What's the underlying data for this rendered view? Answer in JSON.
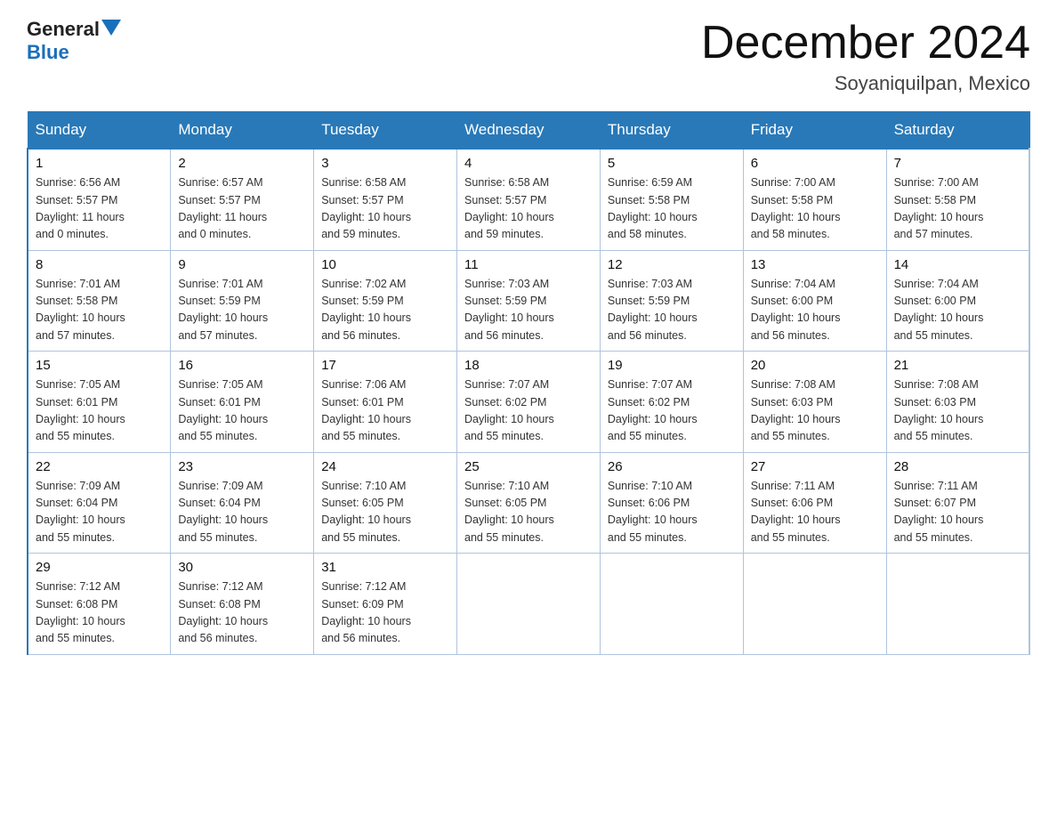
{
  "header": {
    "logo_general": "General",
    "logo_blue": "Blue",
    "month_title": "December 2024",
    "location": "Soyaniquilpan, Mexico"
  },
  "days_of_week": [
    "Sunday",
    "Monday",
    "Tuesday",
    "Wednesday",
    "Thursday",
    "Friday",
    "Saturday"
  ],
  "weeks": [
    [
      {
        "day": "1",
        "sunrise": "6:56 AM",
        "sunset": "5:57 PM",
        "daylight": "11 hours and 0 minutes."
      },
      {
        "day": "2",
        "sunrise": "6:57 AM",
        "sunset": "5:57 PM",
        "daylight": "11 hours and 0 minutes."
      },
      {
        "day": "3",
        "sunrise": "6:58 AM",
        "sunset": "5:57 PM",
        "daylight": "10 hours and 59 minutes."
      },
      {
        "day": "4",
        "sunrise": "6:58 AM",
        "sunset": "5:57 PM",
        "daylight": "10 hours and 59 minutes."
      },
      {
        "day": "5",
        "sunrise": "6:59 AM",
        "sunset": "5:58 PM",
        "daylight": "10 hours and 58 minutes."
      },
      {
        "day": "6",
        "sunrise": "7:00 AM",
        "sunset": "5:58 PM",
        "daylight": "10 hours and 58 minutes."
      },
      {
        "day": "7",
        "sunrise": "7:00 AM",
        "sunset": "5:58 PM",
        "daylight": "10 hours and 57 minutes."
      }
    ],
    [
      {
        "day": "8",
        "sunrise": "7:01 AM",
        "sunset": "5:58 PM",
        "daylight": "10 hours and 57 minutes."
      },
      {
        "day": "9",
        "sunrise": "7:01 AM",
        "sunset": "5:59 PM",
        "daylight": "10 hours and 57 minutes."
      },
      {
        "day": "10",
        "sunrise": "7:02 AM",
        "sunset": "5:59 PM",
        "daylight": "10 hours and 56 minutes."
      },
      {
        "day": "11",
        "sunrise": "7:03 AM",
        "sunset": "5:59 PM",
        "daylight": "10 hours and 56 minutes."
      },
      {
        "day": "12",
        "sunrise": "7:03 AM",
        "sunset": "5:59 PM",
        "daylight": "10 hours and 56 minutes."
      },
      {
        "day": "13",
        "sunrise": "7:04 AM",
        "sunset": "6:00 PM",
        "daylight": "10 hours and 56 minutes."
      },
      {
        "day": "14",
        "sunrise": "7:04 AM",
        "sunset": "6:00 PM",
        "daylight": "10 hours and 55 minutes."
      }
    ],
    [
      {
        "day": "15",
        "sunrise": "7:05 AM",
        "sunset": "6:01 PM",
        "daylight": "10 hours and 55 minutes."
      },
      {
        "day": "16",
        "sunrise": "7:05 AM",
        "sunset": "6:01 PM",
        "daylight": "10 hours and 55 minutes."
      },
      {
        "day": "17",
        "sunrise": "7:06 AM",
        "sunset": "6:01 PM",
        "daylight": "10 hours and 55 minutes."
      },
      {
        "day": "18",
        "sunrise": "7:07 AM",
        "sunset": "6:02 PM",
        "daylight": "10 hours and 55 minutes."
      },
      {
        "day": "19",
        "sunrise": "7:07 AM",
        "sunset": "6:02 PM",
        "daylight": "10 hours and 55 minutes."
      },
      {
        "day": "20",
        "sunrise": "7:08 AM",
        "sunset": "6:03 PM",
        "daylight": "10 hours and 55 minutes."
      },
      {
        "day": "21",
        "sunrise": "7:08 AM",
        "sunset": "6:03 PM",
        "daylight": "10 hours and 55 minutes."
      }
    ],
    [
      {
        "day": "22",
        "sunrise": "7:09 AM",
        "sunset": "6:04 PM",
        "daylight": "10 hours and 55 minutes."
      },
      {
        "day": "23",
        "sunrise": "7:09 AM",
        "sunset": "6:04 PM",
        "daylight": "10 hours and 55 minutes."
      },
      {
        "day": "24",
        "sunrise": "7:10 AM",
        "sunset": "6:05 PM",
        "daylight": "10 hours and 55 minutes."
      },
      {
        "day": "25",
        "sunrise": "7:10 AM",
        "sunset": "6:05 PM",
        "daylight": "10 hours and 55 minutes."
      },
      {
        "day": "26",
        "sunrise": "7:10 AM",
        "sunset": "6:06 PM",
        "daylight": "10 hours and 55 minutes."
      },
      {
        "day": "27",
        "sunrise": "7:11 AM",
        "sunset": "6:06 PM",
        "daylight": "10 hours and 55 minutes."
      },
      {
        "day": "28",
        "sunrise": "7:11 AM",
        "sunset": "6:07 PM",
        "daylight": "10 hours and 55 minutes."
      }
    ],
    [
      {
        "day": "29",
        "sunrise": "7:12 AM",
        "sunset": "6:08 PM",
        "daylight": "10 hours and 55 minutes."
      },
      {
        "day": "30",
        "sunrise": "7:12 AM",
        "sunset": "6:08 PM",
        "daylight": "10 hours and 56 minutes."
      },
      {
        "day": "31",
        "sunrise": "7:12 AM",
        "sunset": "6:09 PM",
        "daylight": "10 hours and 56 minutes."
      },
      null,
      null,
      null,
      null
    ]
  ],
  "labels": {
    "sunrise": "Sunrise: ",
    "sunset": "Sunset: ",
    "daylight": "Daylight: "
  }
}
